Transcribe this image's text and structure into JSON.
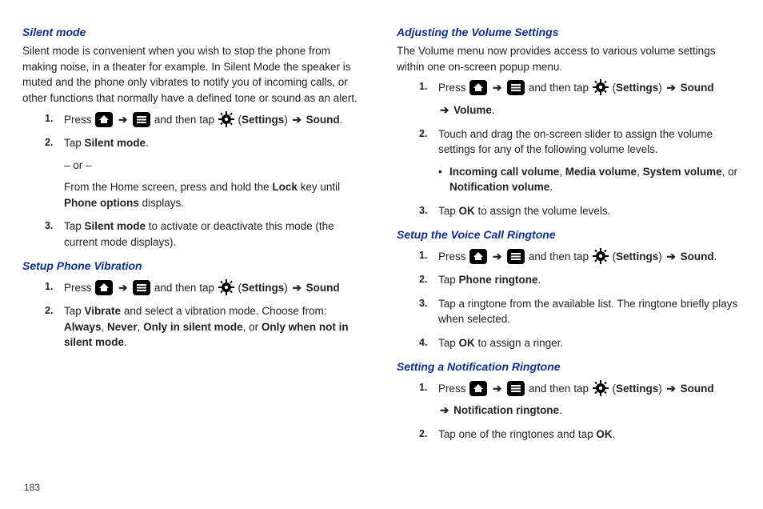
{
  "page_number": "183",
  "arrow": "➔",
  "labels": {
    "settings": "Settings",
    "sound": "Sound",
    "press": "Press",
    "tap": "Tap",
    "and_then_tap": "and then tap",
    "ok": "OK"
  },
  "left": {
    "silent": {
      "title": "Silent mode",
      "para": "Silent mode is convenient when you wish to stop the phone from making noise, in a theater for example. In Silent Mode the speaker is muted and the phone only vibrates to notify you of incoming calls, or other functions that normally have a defined tone or sound as an alert.",
      "steps": {
        "s1_suffix": ".",
        "s2_prefix": "Tap ",
        "s2_bold": "Silent mode",
        "s2_suffix": ".",
        "s2_or": "– or –",
        "s2_alt_a": "From the Home screen, press and hold the ",
        "s2_alt_bold1": "Lock",
        "s2_alt_b": " key until ",
        "s2_alt_bold2": "Phone options",
        "s2_alt_c": " displays.",
        "s3_prefix": "Tap ",
        "s3_bold": "Silent mode",
        "s3_suffix": " to activate or deactivate this mode (the current mode displays)."
      }
    },
    "vibration": {
      "title": "Setup Phone Vibration",
      "steps": {
        "s2_prefix": "Tap ",
        "s2_bold1": "Vibrate",
        "s2_mid": " and select a vibration mode. Choose from: ",
        "s2_b_always": "Always",
        "s2_b_never": "Never",
        "s2_b_only_silent": "Only in silent mode",
        "s2_b_only_not": "Only when not in silent mode",
        "comma": ", ",
        "or": ", or ",
        "period": "."
      }
    }
  },
  "right": {
    "volume": {
      "title": "Adjusting the Volume Settings",
      "para": "The Volume menu now provides access to various volume settings within one on-screen popup menu.",
      "s1_extra_bold": "Volume",
      "s2": "Touch and drag the on-screen slider to assign the volume settings for any of the following volume levels.",
      "bullet_b1": "Incoming call volume",
      "bullet_b2": "Media volume",
      "bullet_b3": "System volume",
      "bullet_b4": "Notification volume",
      "comma": ", ",
      "or": ", or ",
      "period": ".",
      "s3_a": "Tap ",
      "s3_b": " to assign the volume levels."
    },
    "voice": {
      "title": "Setup the Voice Call Ringtone",
      "s2_a": "Tap ",
      "s2_bold": "Phone ringtone",
      "s2_b": ".",
      "s3": "Tap a ringtone from the available list. The ringtone briefly plays when selected.",
      "s4_a": "Tap ",
      "s4_b": " to assign a ringer."
    },
    "notif": {
      "title": "Setting a Notification Ringtone",
      "s1_extra_bold": "Notification ringtone",
      "s2_a": "Tap one of the ringtones and tap ",
      "s2_b": "."
    }
  }
}
